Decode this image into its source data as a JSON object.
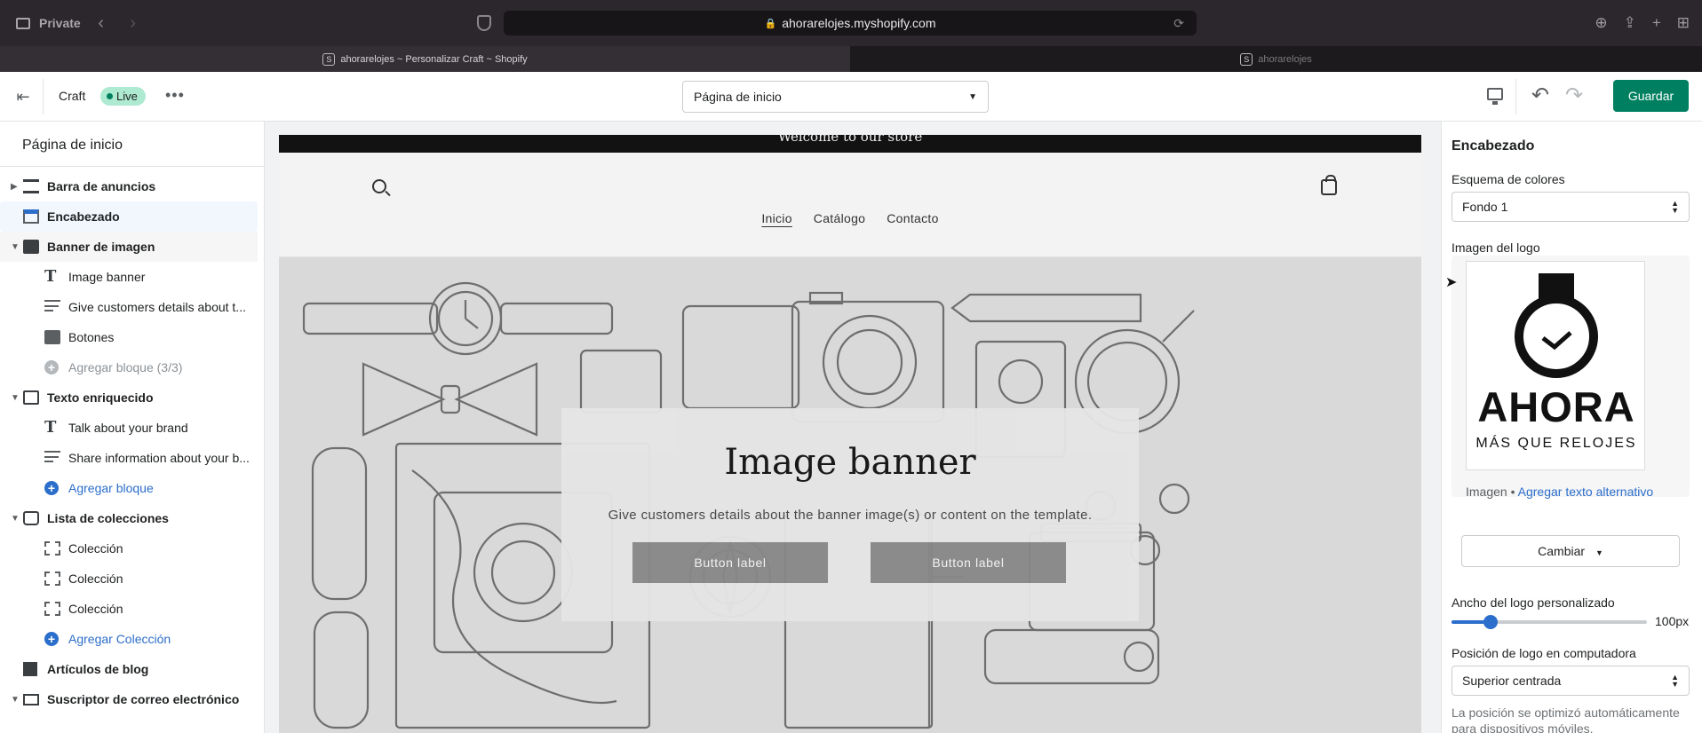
{
  "browser": {
    "mode_label": "Private",
    "url": "ahorarelojes.myshopify.com",
    "tabs": [
      {
        "label": "ahorarelojes ~ Personalizar Craft ~ Shopify",
        "favicon": "shopify-icon"
      },
      {
        "label": "ahorarelojes",
        "favicon": "shopify-icon"
      }
    ]
  },
  "editor": {
    "theme_name": "Craft",
    "live_label": "Live",
    "page_select_value": "Página de inicio",
    "save_label": "Guardar"
  },
  "sidebar": {
    "title": "Página de inicio",
    "items": [
      {
        "label": "Barra de anuncios",
        "level": 0,
        "icon": "announcement-bar-icon"
      },
      {
        "label": "Encabezado",
        "level": 0,
        "icon": "header-icon",
        "selected": true
      },
      {
        "label": "Banner de imagen",
        "level": 0,
        "icon": "image-icon"
      },
      {
        "label": "Image banner",
        "level": 1,
        "icon": "text-icon"
      },
      {
        "label": "Give customers details about t...",
        "level": 1,
        "icon": "paragraph-icon"
      },
      {
        "label": "Botones",
        "level": 1,
        "icon": "buttons-icon"
      },
      {
        "label": "Agregar bloque (3/3)",
        "level": 1,
        "icon": "add-icon",
        "disabled": true
      },
      {
        "label": "Texto enriquecido",
        "level": 0,
        "icon": "rich-text-icon"
      },
      {
        "label": "Talk about your brand",
        "level": 1,
        "icon": "text-icon"
      },
      {
        "label": "Share information about your b...",
        "level": 1,
        "icon": "paragraph-icon"
      },
      {
        "label": "Agregar bloque",
        "level": 1,
        "icon": "add-icon"
      },
      {
        "label": "Lista de colecciones",
        "level": 0,
        "icon": "collection-icon"
      },
      {
        "label": "Colección",
        "level": 1,
        "icon": "collection-placeholder-icon"
      },
      {
        "label": "Colección",
        "level": 1,
        "icon": "collection-placeholder-icon"
      },
      {
        "label": "Colección",
        "level": 1,
        "icon": "collection-placeholder-icon"
      },
      {
        "label": "Agregar Colección",
        "level": 1,
        "icon": "add-icon"
      },
      {
        "label": "Artículos de blog",
        "level": 0,
        "icon": "blog-icon"
      },
      {
        "label": "Suscriptor de correo electrónico",
        "level": 0,
        "icon": "email-icon"
      }
    ]
  },
  "preview": {
    "announcement": "Welcome to our store",
    "nav": [
      "Inicio",
      "Catálogo",
      "Contacto"
    ],
    "banner": {
      "title": "Image banner",
      "text": "Give customers details about the banner image(s) or content on the template.",
      "button1": "Button label",
      "button2": "Button label"
    }
  },
  "settings": {
    "title": "Encabezado",
    "color_scheme_label": "Esquema de colores",
    "color_scheme_value": "Fondo 1",
    "logo_label": "Imagen del logo",
    "logo_brand": "AHORA",
    "logo_tagline": "MÁS QUE RELOJES",
    "image_prefix": "Imagen •",
    "alt_text_link": "Agregar texto alternativo",
    "change_label": "Cambiar",
    "logo_width_label": "Ancho del logo personalizado",
    "logo_width_value": "100px",
    "logo_width_fraction": 0.2,
    "logo_position_label": "Posición de logo en computadora",
    "logo_position_value": "Superior centrada",
    "help_text": "La posición se optimizó automáticamente para dispositivos móviles."
  },
  "colors": {
    "accent": "#008060",
    "link": "#2c6ecb",
    "selected_row": "#f2f7fe"
  }
}
